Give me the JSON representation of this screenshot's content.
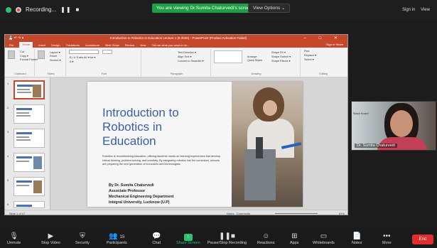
{
  "topbar": {
    "recording_label": "Recording...",
    "pause_glyph": "❚❚",
    "stop_glyph": "■",
    "viewing_banner": "You are viewing Dr.Sumita Chaturvedi's screen",
    "view_options": "View Options",
    "view_options_caret": "⌄",
    "signin": "Sign in",
    "view": "View"
  },
  "ppt": {
    "window_title": "Introduction to Robotics in Education Lecture 1 (5 2020) - PowerPoint (Product Activation Failed)",
    "window_controls": "– □ ✕",
    "quick_access": "💾 ↶ ↷ ▾",
    "menu_items": [
      "File",
      "Home",
      "Insert",
      "Design",
      "Transitions",
      "Animations",
      "Slide Show",
      "Review",
      "View",
      "Tell me what you want to do..."
    ],
    "menu_right": "Sign in  Share",
    "ribbon_groups": [
      {
        "rows": [
          "Cut",
          "Copy ▾",
          "Format Painter"
        ],
        "caption": "Clipboard"
      },
      {
        "rows": [
          "Layout ▾",
          "Reset",
          "Section ▾"
        ],
        "caption": "Slides"
      },
      {
        "rows": [
          "B I U S abc AV ▾ Aa ▾",
          "A ▾"
        ],
        "caption": "Font"
      },
      {
        "rows": [
          "Text Direction ▾",
          "Align Text ▾",
          "Convert to SmartArt ▾"
        ],
        "caption": "Paragraph"
      },
      {
        "rows": [
          "Arrange",
          "Quick Styles"
        ],
        "caption": "Drawing"
      },
      {
        "rows": [
          "Shape Fill ▾",
          "Shape Outline ▾",
          "Shape Effects ▾"
        ],
        "caption": ""
      },
      {
        "rows": [
          "Find",
          "Replace ▾",
          "Select ▾"
        ],
        "caption": "Editing"
      }
    ],
    "slide_numbers": [
      "1",
      "2",
      "3",
      "4",
      "5",
      "6"
    ],
    "slide": {
      "title": "Introduction to Robotics in Education",
      "body": "Robotics is revolutionizing education, offering students hands-on learning experiences that develop critical thinking, problem-solving, and creativity. By integrating robotics into the curriculum, schools are preparing the next generation of innovators and technologists.",
      "author_lines": [
        "By Dr. Sumita Chaturvedi",
        "Associate Professor",
        "Mechanical Engineering Department",
        "Integral University, Lucknow (U.P)"
      ]
    },
    "status": {
      "left": "Slide 1 of 17",
      "notes": "Notes",
      "comments": "Comments",
      "zoom": "61%"
    }
  },
  "video": {
    "name": "Dr. Sumita Chaturvedi",
    "board_text": "Black Board"
  },
  "toolbar": {
    "items": [
      {
        "label": "Unmute",
        "icon": "microphone-muted-icon",
        "glyph": "🎙"
      },
      {
        "label": "Stop Video",
        "icon": "video-camera-icon",
        "glyph": "▶"
      },
      {
        "label": "Security",
        "icon": "shield-icon",
        "glyph": "⛨"
      },
      {
        "label": "Participants",
        "icon": "participants-icon",
        "glyph": "👥",
        "count": "15"
      },
      {
        "label": "Chat",
        "icon": "chat-icon",
        "glyph": "💬"
      },
      {
        "label": "Share Screen",
        "icon": "share-screen-icon",
        "glyph": "↑"
      },
      {
        "label": "Pause/Stop Recording",
        "icon": "pause-recording-icon",
        "glyph": "❚❚■"
      },
      {
        "label": "Reactions",
        "icon": "reactions-icon",
        "glyph": "☺"
      },
      {
        "label": "Apps",
        "icon": "apps-icon",
        "glyph": "⊞"
      },
      {
        "label": "Whiteboards",
        "icon": "whiteboard-icon",
        "glyph": "▭"
      },
      {
        "label": "Notes",
        "icon": "notes-icon",
        "glyph": "📄"
      },
      {
        "label": "More",
        "icon": "more-icon",
        "glyph": "•••"
      }
    ],
    "end_label": "End"
  }
}
